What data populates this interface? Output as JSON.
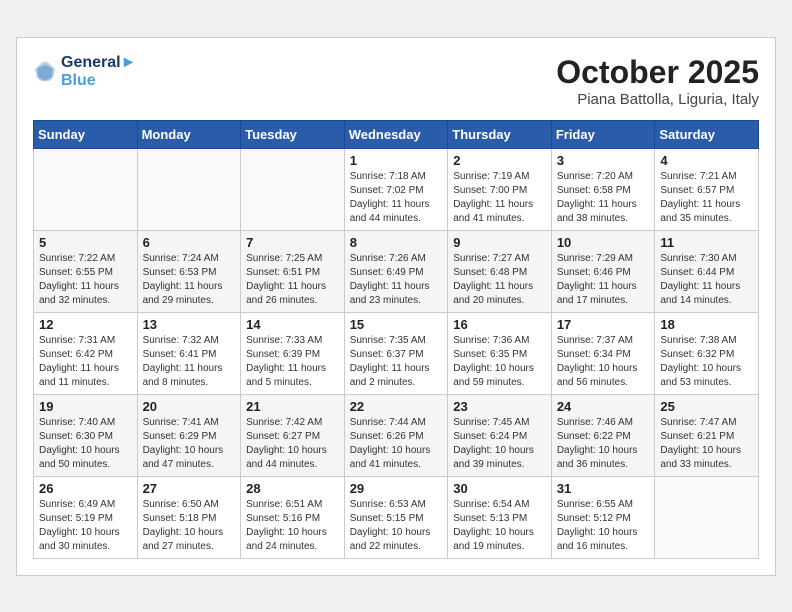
{
  "header": {
    "logo_line1": "General",
    "logo_line2": "Blue",
    "month_title": "October 2025",
    "subtitle": "Piana Battolla, Liguria, Italy"
  },
  "weekdays": [
    "Sunday",
    "Monday",
    "Tuesday",
    "Wednesday",
    "Thursday",
    "Friday",
    "Saturday"
  ],
  "weeks": [
    [
      {
        "day": "",
        "info": ""
      },
      {
        "day": "",
        "info": ""
      },
      {
        "day": "",
        "info": ""
      },
      {
        "day": "1",
        "info": "Sunrise: 7:18 AM\nSunset: 7:02 PM\nDaylight: 11 hours\nand 44 minutes."
      },
      {
        "day": "2",
        "info": "Sunrise: 7:19 AM\nSunset: 7:00 PM\nDaylight: 11 hours\nand 41 minutes."
      },
      {
        "day": "3",
        "info": "Sunrise: 7:20 AM\nSunset: 6:58 PM\nDaylight: 11 hours\nand 38 minutes."
      },
      {
        "day": "4",
        "info": "Sunrise: 7:21 AM\nSunset: 6:57 PM\nDaylight: 11 hours\nand 35 minutes."
      }
    ],
    [
      {
        "day": "5",
        "info": "Sunrise: 7:22 AM\nSunset: 6:55 PM\nDaylight: 11 hours\nand 32 minutes."
      },
      {
        "day": "6",
        "info": "Sunrise: 7:24 AM\nSunset: 6:53 PM\nDaylight: 11 hours\nand 29 minutes."
      },
      {
        "day": "7",
        "info": "Sunrise: 7:25 AM\nSunset: 6:51 PM\nDaylight: 11 hours\nand 26 minutes."
      },
      {
        "day": "8",
        "info": "Sunrise: 7:26 AM\nSunset: 6:49 PM\nDaylight: 11 hours\nand 23 minutes."
      },
      {
        "day": "9",
        "info": "Sunrise: 7:27 AM\nSunset: 6:48 PM\nDaylight: 11 hours\nand 20 minutes."
      },
      {
        "day": "10",
        "info": "Sunrise: 7:29 AM\nSunset: 6:46 PM\nDaylight: 11 hours\nand 17 minutes."
      },
      {
        "day": "11",
        "info": "Sunrise: 7:30 AM\nSunset: 6:44 PM\nDaylight: 11 hours\nand 14 minutes."
      }
    ],
    [
      {
        "day": "12",
        "info": "Sunrise: 7:31 AM\nSunset: 6:42 PM\nDaylight: 11 hours\nand 11 minutes."
      },
      {
        "day": "13",
        "info": "Sunrise: 7:32 AM\nSunset: 6:41 PM\nDaylight: 11 hours\nand 8 minutes."
      },
      {
        "day": "14",
        "info": "Sunrise: 7:33 AM\nSunset: 6:39 PM\nDaylight: 11 hours\nand 5 minutes."
      },
      {
        "day": "15",
        "info": "Sunrise: 7:35 AM\nSunset: 6:37 PM\nDaylight: 11 hours\nand 2 minutes."
      },
      {
        "day": "16",
        "info": "Sunrise: 7:36 AM\nSunset: 6:35 PM\nDaylight: 10 hours\nand 59 minutes."
      },
      {
        "day": "17",
        "info": "Sunrise: 7:37 AM\nSunset: 6:34 PM\nDaylight: 10 hours\nand 56 minutes."
      },
      {
        "day": "18",
        "info": "Sunrise: 7:38 AM\nSunset: 6:32 PM\nDaylight: 10 hours\nand 53 minutes."
      }
    ],
    [
      {
        "day": "19",
        "info": "Sunrise: 7:40 AM\nSunset: 6:30 PM\nDaylight: 10 hours\nand 50 minutes."
      },
      {
        "day": "20",
        "info": "Sunrise: 7:41 AM\nSunset: 6:29 PM\nDaylight: 10 hours\nand 47 minutes."
      },
      {
        "day": "21",
        "info": "Sunrise: 7:42 AM\nSunset: 6:27 PM\nDaylight: 10 hours\nand 44 minutes."
      },
      {
        "day": "22",
        "info": "Sunrise: 7:44 AM\nSunset: 6:26 PM\nDaylight: 10 hours\nand 41 minutes."
      },
      {
        "day": "23",
        "info": "Sunrise: 7:45 AM\nSunset: 6:24 PM\nDaylight: 10 hours\nand 39 minutes."
      },
      {
        "day": "24",
        "info": "Sunrise: 7:46 AM\nSunset: 6:22 PM\nDaylight: 10 hours\nand 36 minutes."
      },
      {
        "day": "25",
        "info": "Sunrise: 7:47 AM\nSunset: 6:21 PM\nDaylight: 10 hours\nand 33 minutes."
      }
    ],
    [
      {
        "day": "26",
        "info": "Sunrise: 6:49 AM\nSunset: 5:19 PM\nDaylight: 10 hours\nand 30 minutes."
      },
      {
        "day": "27",
        "info": "Sunrise: 6:50 AM\nSunset: 5:18 PM\nDaylight: 10 hours\nand 27 minutes."
      },
      {
        "day": "28",
        "info": "Sunrise: 6:51 AM\nSunset: 5:16 PM\nDaylight: 10 hours\nand 24 minutes."
      },
      {
        "day": "29",
        "info": "Sunrise: 6:53 AM\nSunset: 5:15 PM\nDaylight: 10 hours\nand 22 minutes."
      },
      {
        "day": "30",
        "info": "Sunrise: 6:54 AM\nSunset: 5:13 PM\nDaylight: 10 hours\nand 19 minutes."
      },
      {
        "day": "31",
        "info": "Sunrise: 6:55 AM\nSunset: 5:12 PM\nDaylight: 10 hours\nand 16 minutes."
      },
      {
        "day": "",
        "info": ""
      }
    ]
  ]
}
